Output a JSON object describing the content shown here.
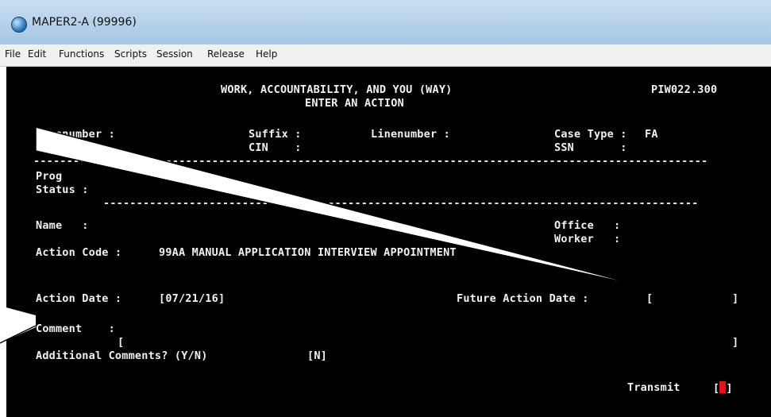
{
  "window": {
    "title": "MAPER2-A (99996)"
  },
  "menu": [
    "File",
    "Edit",
    "Functions",
    "Scripts",
    "Session",
    "Release",
    "Help"
  ],
  "terminal": {
    "header_title": "WORK, ACCOUNTABILITY, AND YOU (WAY)",
    "screen_id": "PIW022.300",
    "subtitle": "ENTER AN ACTION",
    "casenumber_label": "Casenumber :",
    "suffix_label": "Suffix :",
    "linenumber_label": "Linenumber :",
    "casetype_label": "Case Type :",
    "casetype_value": "FA",
    "arreg_label": "Arreg     :",
    "cin_label": "CIN    :",
    "ssn_label": "SSN       :",
    "prog_label": "Prog",
    "status_label": "Status :",
    "name_label": "Name   :",
    "office_label": "Office   :",
    "worker_label": "Worker   :",
    "action_code_label": "Action Code :",
    "action_code_value": "99AA MANUAL APPLICATION INTERVIEW APPOINTMENT",
    "action_date_label": "Action Date :",
    "action_date_value": "[07/21/16]",
    "future_date_label": "Future Action Date :",
    "future_date_open": "[",
    "future_date_close": "]",
    "comment_label": "Comment    :",
    "comment_open": "[",
    "comment_close": "]",
    "additional_label": "Additional Comments? (Y/N)",
    "additional_value": "[N]",
    "transmit_label": "Transmit",
    "transmit_open": "[",
    "transmit_close": "]"
  }
}
